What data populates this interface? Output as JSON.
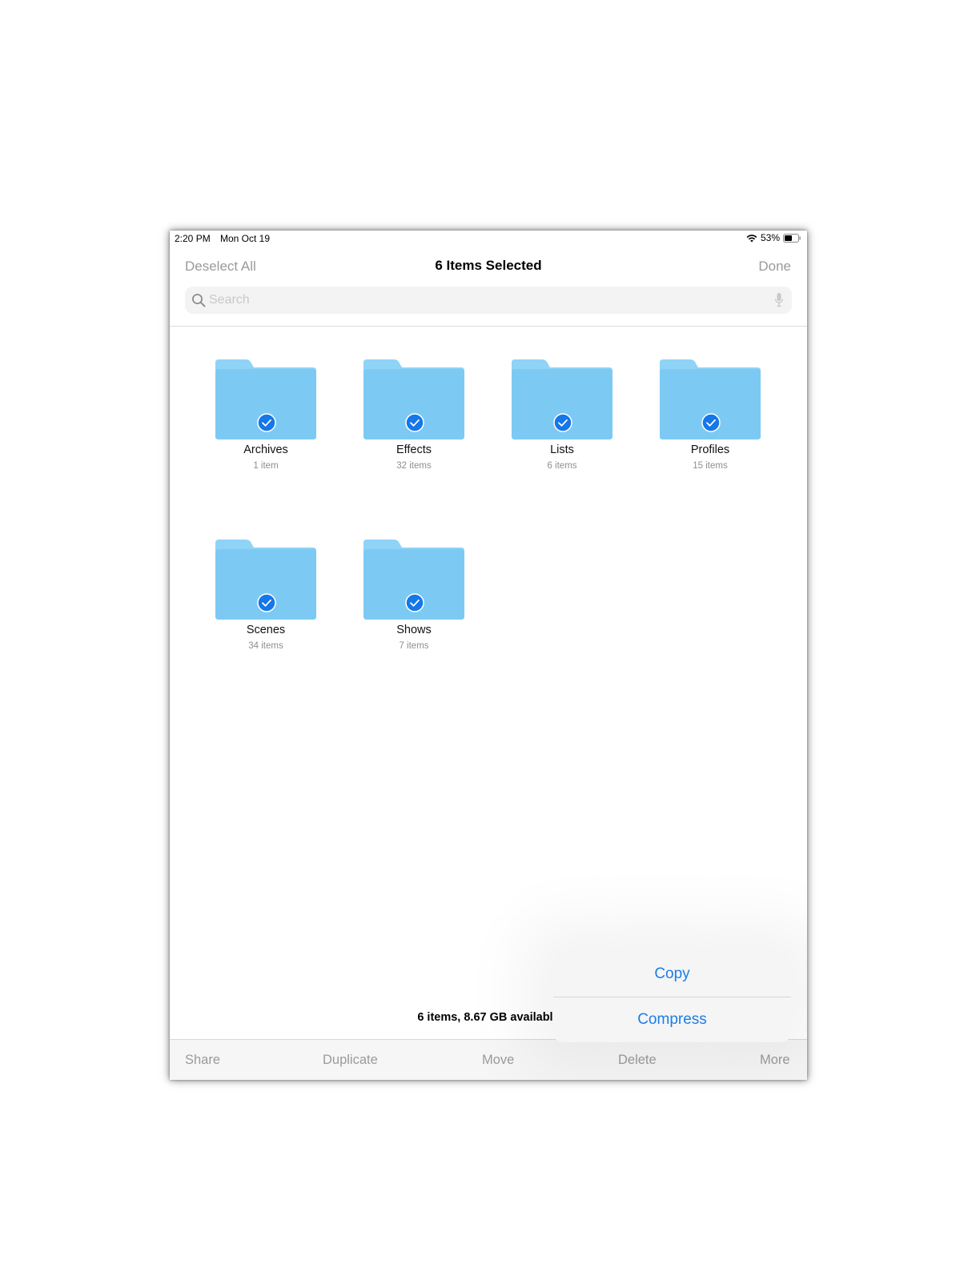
{
  "status_bar": {
    "time": "2:20 PM",
    "date": "Mon Oct 19",
    "battery": "53%"
  },
  "nav": {
    "left": "Deselect All",
    "title": "6 Items Selected",
    "right": "Done"
  },
  "search": {
    "placeholder": "Search"
  },
  "folders": [
    {
      "name": "Archives",
      "count": "1 item",
      "selected": true
    },
    {
      "name": "Effects",
      "count": "32 items",
      "selected": true
    },
    {
      "name": "Lists",
      "count": "6 items",
      "selected": true
    },
    {
      "name": "Profiles",
      "count": "15 items",
      "selected": true
    },
    {
      "name": "Scenes",
      "count": "34 items",
      "selected": true
    },
    {
      "name": "Shows",
      "count": "7 items",
      "selected": true
    }
  ],
  "footer": {
    "summary": "6 items, 8.67 GB available"
  },
  "toolbar": {
    "share": "Share",
    "duplicate": "Duplicate",
    "move": "Move",
    "delete": "Delete",
    "more": "More"
  },
  "popover": {
    "copy": "Copy",
    "compress": "Compress"
  },
  "colors": {
    "accent": "#1a7fe6",
    "folder_top": "#8fd3f7",
    "folder_body": "#7ccaf3",
    "check": "#1577e8"
  },
  "icons": {
    "search": "magnifier-glyph",
    "mic": "microphone-glyph",
    "wifi": "wifi-glyph",
    "battery": "battery-glyph",
    "check": "checkmark-glyph"
  }
}
